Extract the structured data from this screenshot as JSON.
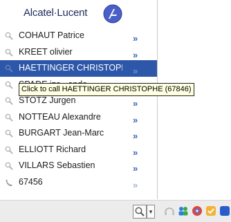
{
  "popup": {
    "brand": "Alcatel·Lucent",
    "contacts": [
      {
        "name": "COHAUT Patrice",
        "icon": "search-icon",
        "chevron": "»"
      },
      {
        "name": "KREET olivier",
        "icon": "search-icon",
        "chevron": "»"
      },
      {
        "name": "HAETTINGER CHRISTOPHE",
        "icon": "search-icon",
        "chevron": "»",
        "selected": true
      },
      {
        "name": "SPADE iza...ando",
        "icon": "search-icon",
        "chevron": "»"
      },
      {
        "name": "STOTZ Jurgen",
        "icon": "search-icon",
        "chevron": "»"
      },
      {
        "name": "NOTTEAU Alexandre",
        "icon": "search-icon",
        "chevron": "»"
      },
      {
        "name": "BURGART Jean-Marc",
        "icon": "search-icon",
        "chevron": "»"
      },
      {
        "name": "ELLIOTT Richard",
        "icon": "search-icon",
        "chevron": "»"
      },
      {
        "name": "VILLARS Sebastien",
        "icon": "search-icon",
        "chevron": "»"
      },
      {
        "name": "67456",
        "icon": "phone-icon",
        "chevron": "»",
        "dim": true
      }
    ],
    "tooltip": "Click to call HAETTINGER CHRISTOPHE (67846)"
  },
  "taskbar": {
    "search_icon": "search-icon",
    "dropdown_icon": "▾"
  },
  "colors": {
    "selected_bg": "#2d57a8",
    "chevron": "#3a63b8",
    "brand": "#1f2a5c",
    "tooltip_bg": "#ffffe1"
  }
}
